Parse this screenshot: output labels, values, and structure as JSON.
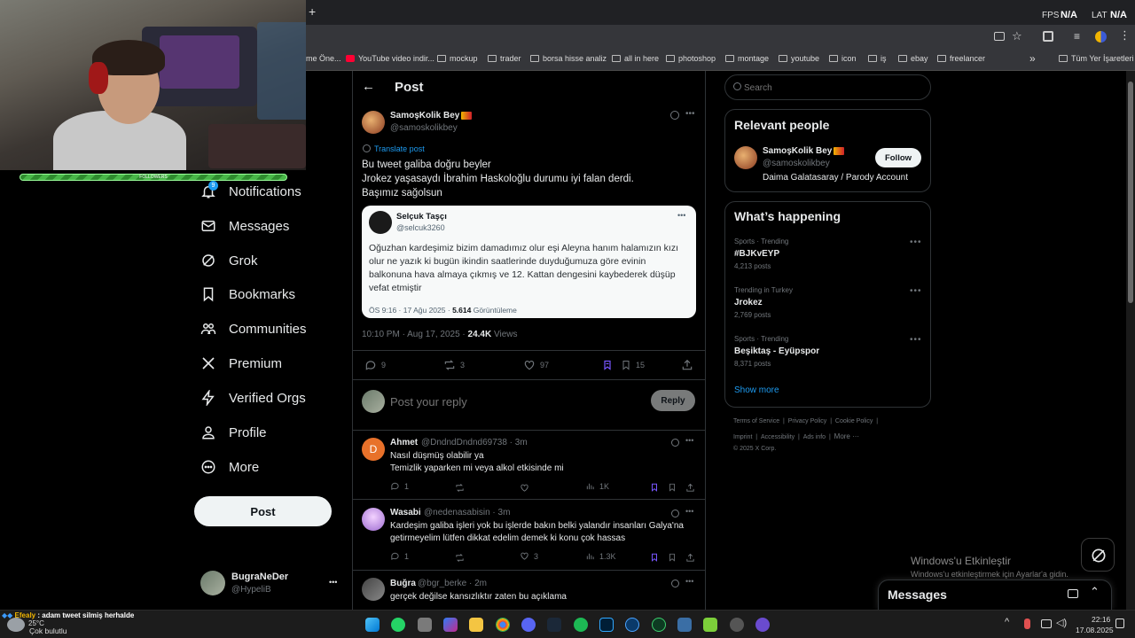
{
  "browser": {
    "plus_tab": "+",
    "fps_label": "FPS",
    "fps_value": "N/A",
    "lat_label": "LAT",
    "lat_value": "N/A",
    "bookmarks": [
      "me Öne...",
      "YouTube video indir...",
      "mockup",
      "trader",
      "borsa hisse analiz",
      "all in here",
      "photoshop",
      "montage",
      "youtube",
      "icon",
      "iş",
      "ebay",
      "freelancer"
    ],
    "bookmarks_more": "»",
    "all_bookmarks": "Tüm Yer İşaretleri"
  },
  "overlay": {
    "follower_bar_label": "FOLLOWERS",
    "badge_count": "9"
  },
  "nav": {
    "items": [
      "Notifications",
      "Messages",
      "Grok",
      "Bookmarks",
      "Communities",
      "Premium",
      "Verified Orgs",
      "Profile",
      "More"
    ],
    "post_button": "Post",
    "account_name": "BugraNeDer",
    "account_handle": "@HypeliB",
    "account_more": "•••"
  },
  "post": {
    "back_arrow": "←",
    "header_title": "Post",
    "author_name": "SamoşKolik Bey",
    "author_handle": "@samoskolikbey",
    "translate_label": "Translate post",
    "text_lines": [
      "Bu tweet galiba doğru beyler",
      "Jrokez yaşasaydı İbrahim Haskoloğlu durumu iyi falan derdi.",
      "Başımız sağolsun"
    ],
    "quote": {
      "author_name": "Selçuk Taşçı",
      "author_handle": "@selcuk3260",
      "text": "Oğuzhan kardeşimiz bizim damadımız olur eşi Aleyna hanım halamızın kızı olur ne yazık ki bugün ikindin saatlerinde duyduğumuza göre evinin balkonuna hava almaya çıkmış ve 12. Kattan dengesini kaybederek düşüp vefat etmiştir",
      "meta_time": "ÖS 9:16 · 17 Ağu 2025 ·",
      "meta_views": "5.614",
      "meta_views_label": "Görüntüleme"
    },
    "timestamp": "10:10 PM · Aug 17, 2025 ·",
    "views": "24.4K",
    "views_label": "Views",
    "replies": "9",
    "reposts": "3",
    "likes": "97",
    "bookmarks": "15",
    "reply_placeholder": "Post your reply",
    "reply_button": "Reply"
  },
  "replies": [
    {
      "name": "Ahmet",
      "handle": "@DndndDndnd69738 · 3m",
      "lines": [
        "Nasıl düşmüş olabilir ya",
        "Temizlik yaparken mi veya alkol etkisinde mi"
      ],
      "replies": "1",
      "reposts": "",
      "likes": "",
      "views": "1K",
      "avatar_letter": "D"
    },
    {
      "name": "Wasabi",
      "handle": "@nedenasabisin · 3m",
      "lines": [
        "Kardeşim galiba işleri yok bu işlerde bakın belki yalandır insanları Galya'na",
        "getirmeyelim lütfen dikkat edelim demek ki konu çok hassas"
      ],
      "replies": "1",
      "reposts": "",
      "likes": "3",
      "views": "1.3K",
      "avatar_letter": ""
    },
    {
      "name": "Buğra",
      "handle": "@bgr_berke · 2m",
      "lines": [
        "gerçek değilse kansızlıktır zaten bu açıklama"
      ],
      "replies": "",
      "reposts": "",
      "likes": "",
      "views": "",
      "avatar_letter": ""
    }
  ],
  "sidebar": {
    "search_placeholder": "Search",
    "relevant_title": "Relevant people",
    "person_name": "SamoşKolik Bey",
    "person_handle": "@samoskolikbey",
    "person_bio": "Daima Galatasaray / Parody Account",
    "follow_button": "Follow",
    "happening_title": "What’s happening",
    "trends": [
      {
        "label": "Sports · Trending",
        "name": "#BJKvEYP",
        "count": "4,213 posts"
      },
      {
        "label": "Trending in Turkey",
        "name": "Jrokez",
        "count": "2,769 posts"
      },
      {
        "label": "Sports · Trending",
        "name": "Beşiktaş - Eyüpspor",
        "count": "8,371 posts"
      }
    ],
    "show_more": "Show more",
    "footer_row1": [
      "Terms of Service",
      "|",
      "Privacy Policy",
      "|",
      "Cookie Policy",
      "|"
    ],
    "footer_row2": [
      "Imprint",
      "|",
      "Accessibility",
      "|",
      "Ads info",
      "|",
      "More ···"
    ],
    "footer_copy": "© 2025 X Corp."
  },
  "windows": {
    "activate_title": "Windows'u Etkinleştir",
    "activate_sub": "Windows'u etkinleştirmek için Ayarlar'a gidin.",
    "messages_drawer": "Messages"
  },
  "taskbar": {
    "notify_user": "Efealy",
    "notify_text": ": adam tweet silmiş herhalde",
    "weather_temp": "25°C",
    "weather_text": "Çok bulutlu",
    "clock_time": "22:16",
    "clock_date": "17.08.2025"
  },
  "colors": {
    "accent": "#1d9bf0",
    "bg": "#000000",
    "border": "#2f3336",
    "muted": "#71767b",
    "bookmark_active": "#7856ff"
  }
}
